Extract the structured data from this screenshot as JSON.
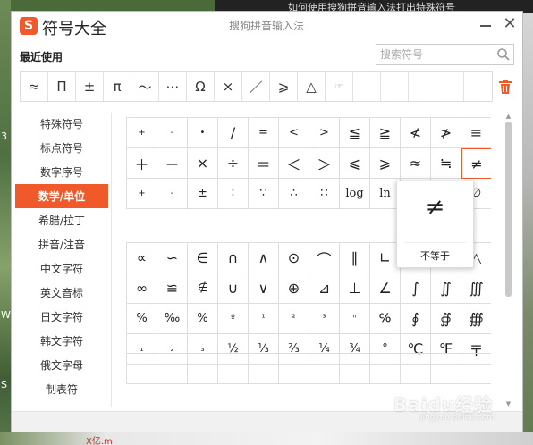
{
  "window": {
    "app_title": "符号大全",
    "ime_name": "搜狗拼音输入法",
    "logo_glyph": "S",
    "close_glyph": "✕",
    "brand_color": "#f0592a"
  },
  "recent": {
    "label": "最近使用",
    "symbols": [
      "≈",
      "Π",
      "±",
      "π",
      "～",
      "⋯",
      "Ω",
      "×",
      "／",
      "⩾",
      "△",
      "☞",
      "",
      "",
      "",
      "",
      ""
    ]
  },
  "search": {
    "placeholder": "搜索符号"
  },
  "sidebar": {
    "items": [
      {
        "label": "特殊符号"
      },
      {
        "label": "标点符号"
      },
      {
        "label": "数字序号"
      },
      {
        "label": "数学/单位",
        "active": true
      },
      {
        "label": "希腊/拉丁"
      },
      {
        "label": "拼音/注音"
      },
      {
        "label": "中文字符"
      },
      {
        "label": "英文音标"
      },
      {
        "label": "日文字符"
      },
      {
        "label": "韩文字符"
      },
      {
        "label": "俄文字母"
      },
      {
        "label": "制表符"
      }
    ]
  },
  "grid1": {
    "rows": [
      [
        "+",
        "-",
        "•",
        "/",
        "=",
        "<",
        ">",
        "≦",
        "≧",
        "≮",
        "≯",
        "≡"
      ],
      [
        "＋",
        "－",
        "×",
        "÷",
        "＝",
        "＜",
        "＞",
        "⩽",
        "⩾",
        "≈",
        "≒",
        "≠"
      ],
      [
        "+",
        "-",
        "±",
        "∶",
        "∵",
        "∴",
        "∷",
        "log",
        "ln",
        "",
        "",
        "∅"
      ]
    ]
  },
  "grid2": {
    "rows": [
      [
        "∝",
        "∽",
        "∈",
        "∩",
        "∧",
        "⊙",
        "⌒",
        "∥",
        "∟",
        "",
        "",
        "△"
      ],
      [
        "∞",
        "≌",
        "∉",
        "∪",
        "∨",
        "⊕",
        "⊿",
        "⊥",
        "∠",
        "∫",
        "∬",
        "∭"
      ],
      [
        "%",
        "‰",
        "%",
        "º",
        "¹",
        "²",
        "³",
        "ⁿ",
        "℅",
        "∮",
        "∯",
        "∰"
      ],
      [
        "₁",
        "₂",
        "₃",
        "½",
        "⅓",
        "⅔",
        "¼",
        "¾",
        "°",
        "℃",
        "℉",
        "〒"
      ]
    ]
  },
  "tooltip": {
    "symbol": "≠",
    "name": "不等于"
  },
  "desktop": {
    "top_text": "如何使用搜狗拼音输入法打出特殊符号",
    "bottom_text": "X亿.m",
    "left_letters": [
      "3",
      "W",
      "S"
    ],
    "watermark": "Baidu经验",
    "watermark_sub": "jingyan.baidu.com"
  }
}
